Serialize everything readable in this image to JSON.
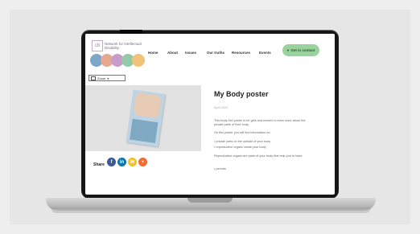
{
  "site": {
    "logo_mark": "cb",
    "logo_text": "Network for Intellectual Disability",
    "nav": [
      "Home",
      "About",
      "Issues",
      "Our truths",
      "Resources",
      "Events"
    ],
    "button_label": "Get in contact",
    "arch_colors": [
      "#7ea6c9",
      "#e6a88e",
      "#c99bc9",
      "#94c9a7",
      "#f0c27a"
    ]
  },
  "viewer": {
    "zoom_label": "Zoom"
  },
  "article": {
    "title": "My Body poster",
    "date": "April 2024",
    "para1": "This body fold poster is for girls and women to learn more about the private parts of their body.",
    "para2": "On this poster you will find information on:",
    "bullets": [
      "private parts on the outside of your body",
      "reproductive organs inside your body"
    ],
    "para3": "Reproductive organs are parts of your body that help you to have:",
    "last_bullet": "periods"
  },
  "share": {
    "label": "Share",
    "icons": [
      {
        "name": "facebook-icon",
        "glyph": "f",
        "color": "#3b5998"
      },
      {
        "name": "linkedin-icon",
        "glyph": "in",
        "color": "#0e76a8"
      },
      {
        "name": "email-icon",
        "glyph": "✉",
        "color": "#f2c22b"
      },
      {
        "name": "more-icon",
        "glyph": "+",
        "color": "#f26e30"
      }
    ]
  }
}
